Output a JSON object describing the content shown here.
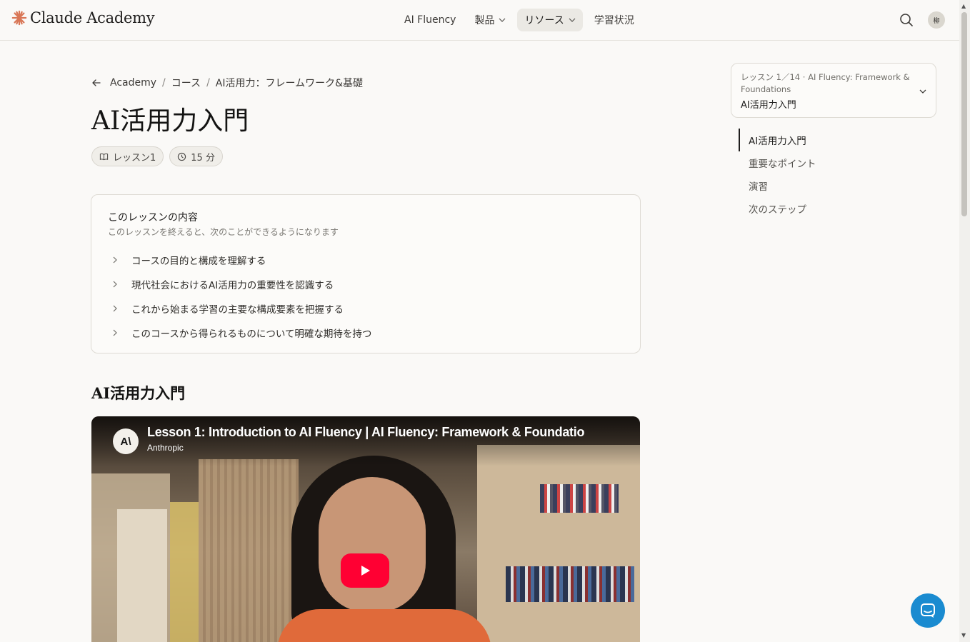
{
  "header": {
    "logo_text": "Claude Academy",
    "nav": [
      {
        "label": "AI Fluency",
        "has_dropdown": false,
        "active": false
      },
      {
        "label": "製品",
        "has_dropdown": true,
        "active": false
      },
      {
        "label": "リソース",
        "has_dropdown": true,
        "active": true
      },
      {
        "label": "学習状況",
        "has_dropdown": false,
        "active": false
      }
    ],
    "avatar_initial": "柳",
    "icons": {
      "search": "search-icon",
      "logo": "sparkle-icon"
    }
  },
  "breadcrumb": {
    "items": [
      "Academy",
      "コース",
      "AI活用力：フレームワーク&基礎"
    ],
    "separator": "/"
  },
  "page": {
    "title": "AI活用力入門",
    "pills": {
      "lesson": "レッスン1",
      "duration": "15 分"
    }
  },
  "objectives": {
    "title": "このレッスンの内容",
    "subtitle": "このレッスンを終えると、次のことができるようになります",
    "items": [
      "コースの目的と構成を理解する",
      "現代社会におけるAI活用力の重要性を認識する",
      "これから始まる学習の主要な構成要素を把握する",
      "このコースから得られるものについて明確な期待を持つ"
    ]
  },
  "section": {
    "title": "AI活用力入門"
  },
  "video": {
    "title": "Lesson 1: Introduction to AI Fluency | AI Fluency: Framework & Foundatio",
    "channel": "Anthropic",
    "channel_logo_text": "A\\",
    "colors": {
      "play_button": "#ff0033"
    }
  },
  "lesson_selector": {
    "meta": "レッスン 1／14 · AI Fluency: Framework & Foundations",
    "current": "AI活用力入門"
  },
  "toc": {
    "items": [
      "AI活用力入門",
      "重要なポイント",
      "演習",
      "次のステップ"
    ],
    "active_index": 0
  },
  "colors": {
    "accent": "#d97757",
    "chat_fab": "#1a8bd0",
    "background": "#faf9f7"
  }
}
